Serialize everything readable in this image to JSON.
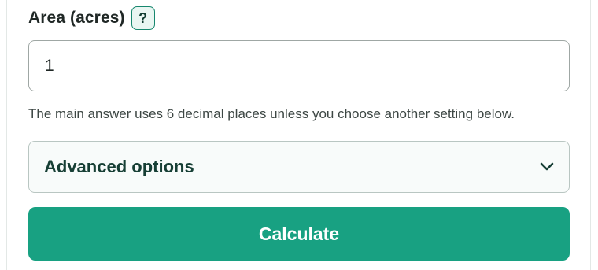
{
  "field": {
    "label": "Area (acres)",
    "help_label": "?",
    "value": "1"
  },
  "hint": "The main answer uses 6 decimal places unless you choose another setting below.",
  "advanced": {
    "label": "Advanced options",
    "icon": "chevron-down-icon"
  },
  "calculate": {
    "label": "Calculate"
  },
  "colors": {
    "accent": "#18a182",
    "help_border": "#17876e",
    "help_bg": "#e9f6f2",
    "heading_text": "#173f35"
  }
}
